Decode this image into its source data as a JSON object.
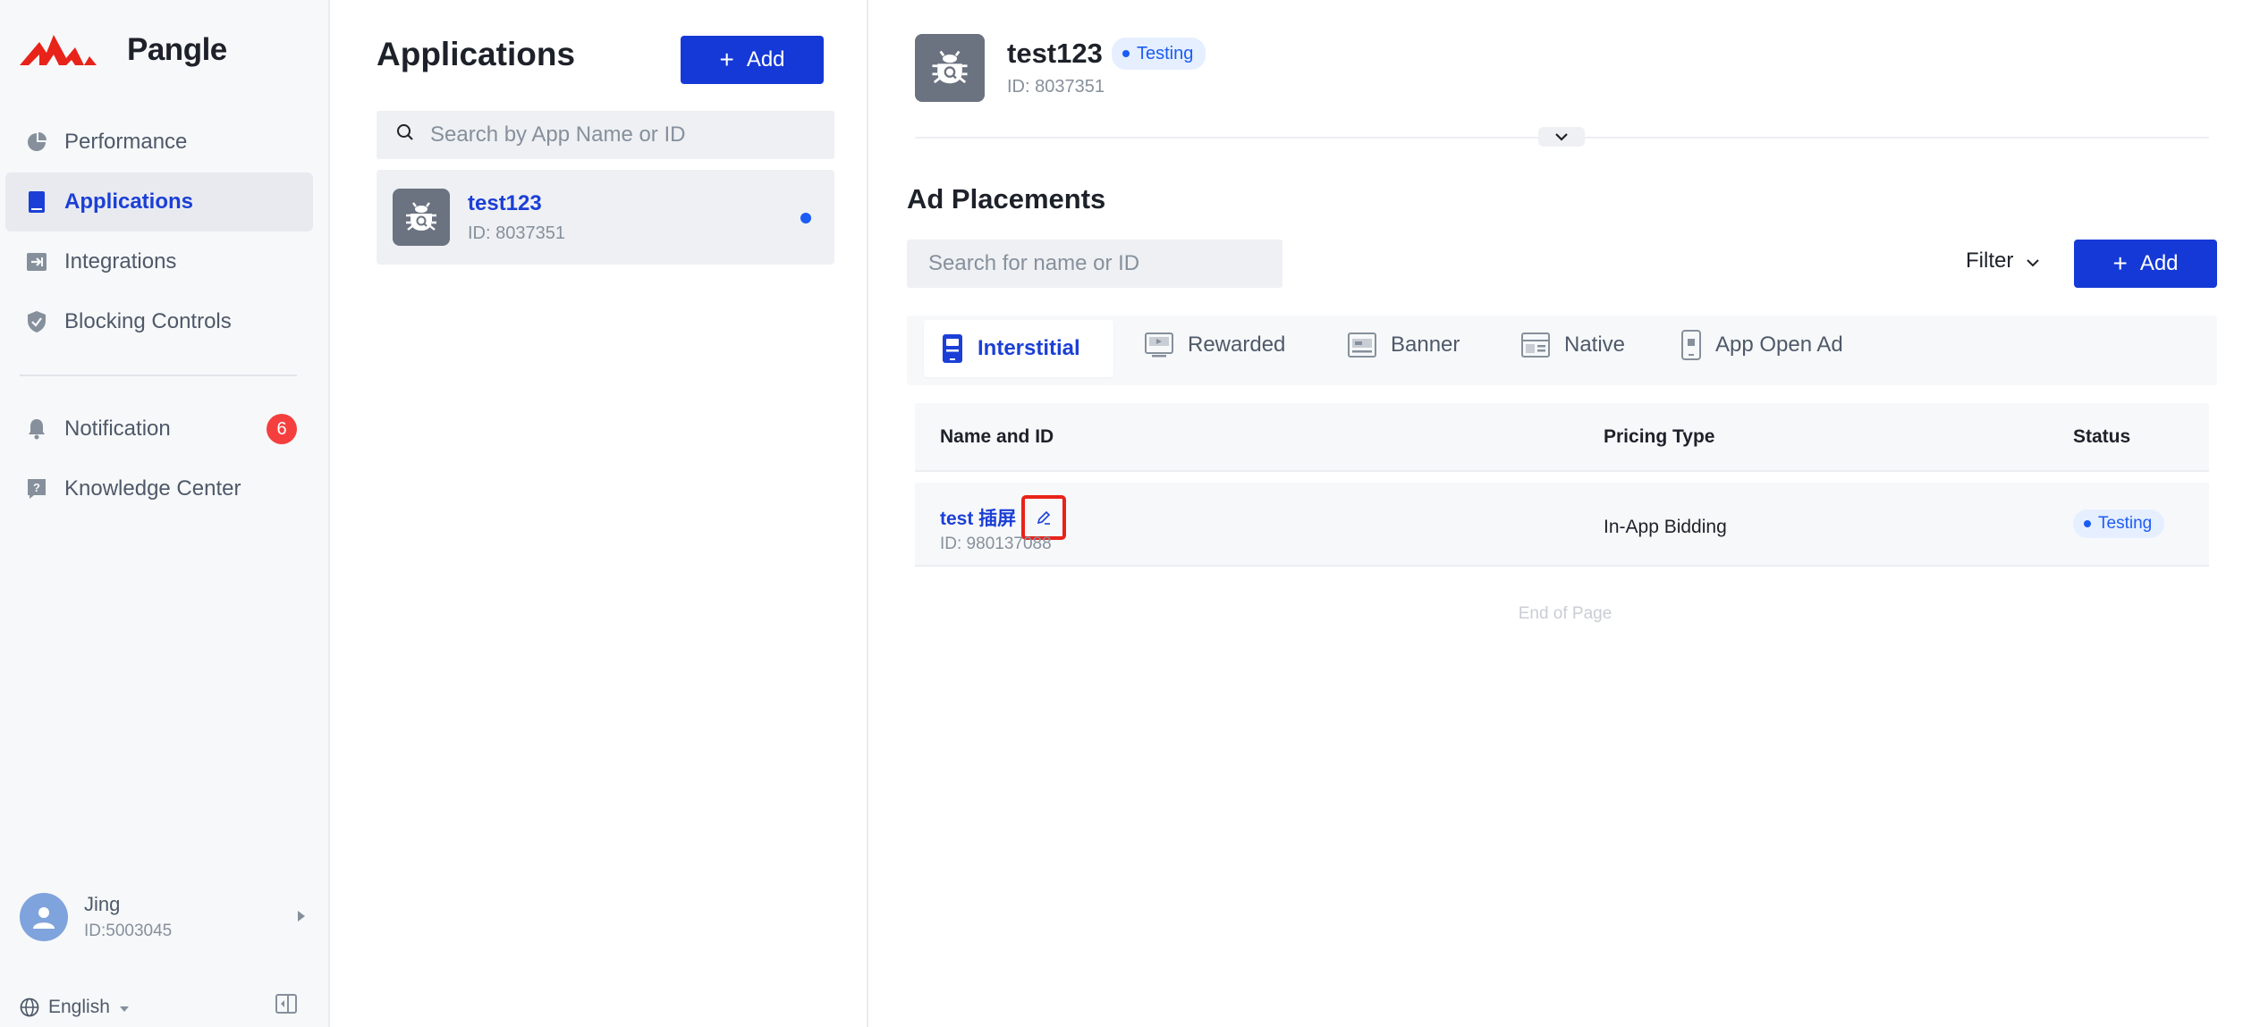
{
  "brand": {
    "name": "Pangle",
    "accent": "#e8231a"
  },
  "sidebar": {
    "items": [
      {
        "label": "Performance",
        "icon": "pie-chart-icon"
      },
      {
        "label": "Applications",
        "icon": "app-phone-icon",
        "active": true
      },
      {
        "label": "Integrations",
        "icon": "integration-icon"
      },
      {
        "label": "Blocking Controls",
        "icon": "shield-icon"
      },
      {
        "label": "Notification",
        "icon": "bell-icon",
        "badge": "6"
      },
      {
        "label": "Knowledge Center",
        "icon": "help-book-icon"
      }
    ],
    "user": {
      "name": "Jing",
      "id": "ID:5003045"
    },
    "language": "English"
  },
  "applications": {
    "title": "Applications",
    "add_label": "Add",
    "search_placeholder": "Search by App Name or ID",
    "list": [
      {
        "name": "test123",
        "id": "ID: 8037351",
        "selected": true
      }
    ]
  },
  "app_detail": {
    "name": "test123",
    "status": "Testing",
    "id": "ID: 8037351"
  },
  "placements": {
    "title": "Ad Placements",
    "search_placeholder": "Search for name or ID",
    "filter_label": "Filter",
    "add_label": "Add",
    "tabs": [
      {
        "label": "Interstitial",
        "icon": "interstitial-icon",
        "active": true
      },
      {
        "label": "Rewarded",
        "icon": "rewarded-icon"
      },
      {
        "label": "Banner",
        "icon": "banner-icon"
      },
      {
        "label": "Native",
        "icon": "native-icon"
      },
      {
        "label": "App Open Ad",
        "icon": "app-open-icon"
      }
    ],
    "columns": [
      "Name and ID",
      "Pricing Type",
      "Status"
    ],
    "rows": [
      {
        "name": "test 插屏",
        "id": "ID: 980137088",
        "pricing": "In-App Bidding",
        "status": "Testing"
      }
    ],
    "end_text": "End of Page"
  },
  "colors": {
    "primary": "#1539d6",
    "link": "#1b3fd6",
    "status_blue": "#1b5cf5",
    "badge_red": "#f53f3f"
  }
}
